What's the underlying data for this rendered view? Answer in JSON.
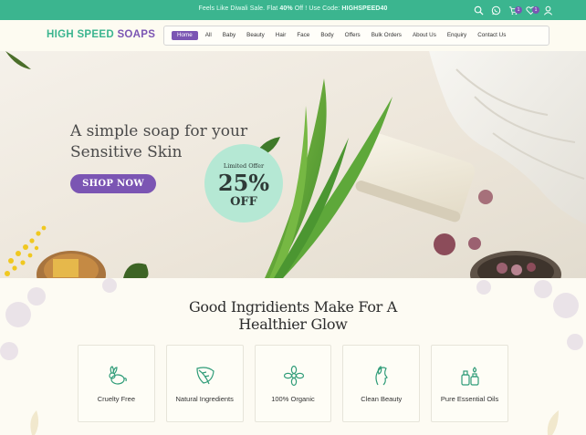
{
  "promo": {
    "prefix": "Feels Like Diwali Sale. Flat ",
    "discount": "40%",
    "middle": " Off ! Use Code: ",
    "code": "HIGHSPEED40"
  },
  "top_icons": {
    "cart_count": "1",
    "wishlist_count": "1"
  },
  "logo": {
    "part1": "HIGH SPEED",
    "part2": "SOAPS"
  },
  "nav": {
    "items": [
      "Home",
      "All",
      "Baby",
      "Beauty",
      "Hair",
      "Face",
      "Body",
      "Offers",
      "Bulk Orders",
      "About Us",
      "Enquiry",
      "Contact Us"
    ],
    "active": "Home"
  },
  "hero": {
    "title_line1": "A simple soap for your",
    "title_line2": "Sensitive Skin",
    "cta": "SHOP NOW",
    "badge_line1": "Limited Offer",
    "badge_line2": "25%",
    "badge_line3": "OFF"
  },
  "features": {
    "title_line1": "Good Ingridients Make For A",
    "title_line2": "Healthier Glow",
    "items": [
      {
        "label": "Cruelty Free",
        "icon": "rabbit-icon"
      },
      {
        "label": "Natural Ingredients",
        "icon": "leaf-icon"
      },
      {
        "label": "100% Organic",
        "icon": "flower-icon"
      },
      {
        "label": "Clean Beauty",
        "icon": "face-leaf-icon"
      },
      {
        "label": "Pure Essential Oils",
        "icon": "oil-bottles-icon"
      }
    ]
  },
  "colors": {
    "accent_green": "#3bb58f",
    "accent_purple": "#7b55b3",
    "badge_mint": "#b5e8d4"
  }
}
